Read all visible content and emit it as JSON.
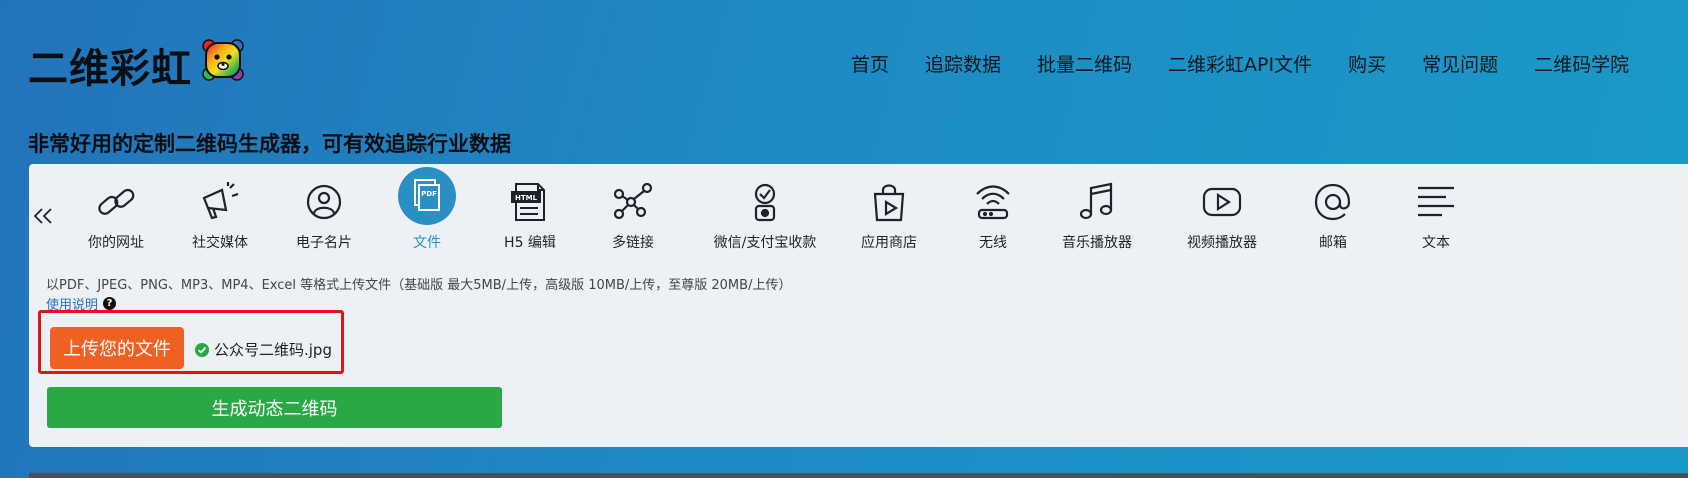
{
  "header": {
    "logo_text": "二维彩虹",
    "logo_icon": "rainbow-bear-icon",
    "nav": [
      "首页",
      "追踪数据",
      "批量二维码",
      "二维彩虹API文件",
      "购买",
      "常见问题",
      "二维码学院"
    ]
  },
  "tagline": "非常好用的定制二维码生成器，可有效追踪行业数据",
  "types": [
    {
      "label": "你的网址",
      "icon": "link-icon"
    },
    {
      "label": "社交媒体",
      "icon": "megaphone-icon"
    },
    {
      "label": "电子名片",
      "icon": "user-card-icon"
    },
    {
      "label": "文件",
      "icon": "pdf-file-icon"
    },
    {
      "label": "H5 编辑",
      "icon": "html-file-icon"
    },
    {
      "label": "多链接",
      "icon": "multi-link-icon"
    },
    {
      "label": "微信/支付宝收款",
      "icon": "payment-icon"
    },
    {
      "label": "应用商店",
      "icon": "app-store-icon"
    },
    {
      "label": "无线",
      "icon": "wifi-router-icon"
    },
    {
      "label": "音乐播放器",
      "icon": "music-note-icon"
    },
    {
      "label": "视频播放器",
      "icon": "video-play-icon"
    },
    {
      "label": "邮箱",
      "icon": "at-sign-icon"
    },
    {
      "label": "文本",
      "icon": "text-lines-icon"
    }
  ],
  "active_type": "文件",
  "upload": {
    "description": "以PDF、JPEG、PNG、MP3、MP4、Excel 等格式上传文件（基础版 最大5MB/上传，高级版 10MB/上传，至尊版 20MB/上传）",
    "help_link": "使用说明",
    "help_symbol": "?",
    "button_label": "上传您的文件",
    "file_name": "公众号二维码.jpg"
  },
  "generate_button": "生成动态二维码",
  "colors": {
    "accent_blue": "#2a8fc3",
    "upload_orange": "#ee6123",
    "generate_green": "#2aa845",
    "highlight_red": "#e0141b"
  }
}
